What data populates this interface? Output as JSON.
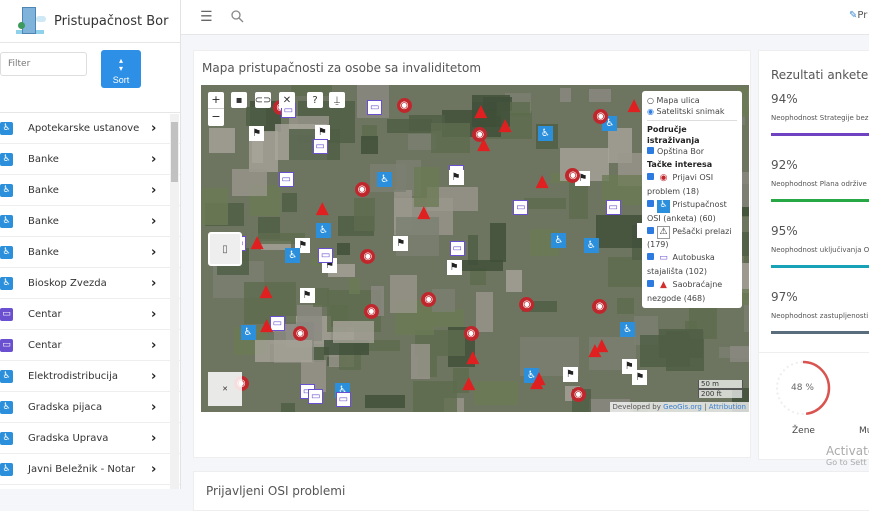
{
  "brand": {
    "name": "Pristupačnost Bor"
  },
  "filter": {
    "placeholder": "Filter"
  },
  "sort": {
    "icon": "sort-icon",
    "label": "Sort"
  },
  "sidebar": {
    "items": [
      {
        "label": "Apotekarske ustanove",
        "icon": "wheelchair"
      },
      {
        "label": "Banke",
        "icon": "wheelchair"
      },
      {
        "label": "Banke",
        "icon": "wheelchair"
      },
      {
        "label": "Banke",
        "icon": "wheelchair"
      },
      {
        "label": "Banke",
        "icon": "wheelchair"
      },
      {
        "label": "Bioskop Zvezda",
        "icon": "wheelchair"
      },
      {
        "label": "Centar",
        "icon": "bus"
      },
      {
        "label": "Centar",
        "icon": "bus"
      },
      {
        "label": "Elektrodistribucija",
        "icon": "wheelchair"
      },
      {
        "label": "Gradska pijaca",
        "icon": "wheelchair"
      },
      {
        "label": "Gradska Uprava",
        "icon": "wheelchair"
      },
      {
        "label": "Javni Beležnik - Notar",
        "icon": "wheelchair"
      }
    ]
  },
  "topbar": {
    "action_label": "Pr"
  },
  "map_card": {
    "title": "Mapa pristupačnosti za osobe sa invaliditetom",
    "legend": {
      "base_street": "Mapa ulica",
      "base_sat": "Satelitski snimak",
      "area_title": "Područje istraživanja",
      "area": "Opština Bor",
      "poi_title": "Tačke interesa",
      "layers": [
        {
          "label": "Prijavi OSI problem (18)",
          "color": "#c0272d"
        },
        {
          "label": "Pristupačnost OSI (anketa) (60)",
          "color": "#2b8fdc"
        },
        {
          "label": "Pešački prelazi (179)",
          "color": "#ffffff"
        },
        {
          "label": "Autobuska stajališta (102)",
          "color": "#6a4fd0"
        },
        {
          "label": "Saobraćajne nezgode (468)",
          "color": "#d32f2f"
        }
      ]
    },
    "scale": [
      "50 m",
      "200 ft"
    ],
    "attribution": {
      "prefix": "Developed by",
      "link1": "GeoGis.org",
      "sep": "|",
      "link2": "Attribution"
    },
    "tools": [
      "+",
      "−"
    ]
  },
  "results": {
    "title": "Rezultati ankete",
    "items": [
      {
        "pct": "94%",
        "label": "Neophodnost Strategije bez",
        "color": "#6f42c1"
      },
      {
        "pct": "92%",
        "label": "Neophodnost Plana održive",
        "color": "#28a745"
      },
      {
        "pct": "95%",
        "label": "Neophodnost uključivanja O",
        "color": "#17a2b8"
      },
      {
        "pct": "97%",
        "label": "Neophodnost zastupljenosti",
        "color": "#5a6d7c"
      }
    ],
    "donut": {
      "value": 48,
      "text": "48 %",
      "label": "Žene",
      "label2": "Mu"
    }
  },
  "bottom_card": {
    "title": "Prijavljeni OSI problemi"
  },
  "watermark": {
    "line1": "Activate",
    "line2": "Go to Sett"
  }
}
